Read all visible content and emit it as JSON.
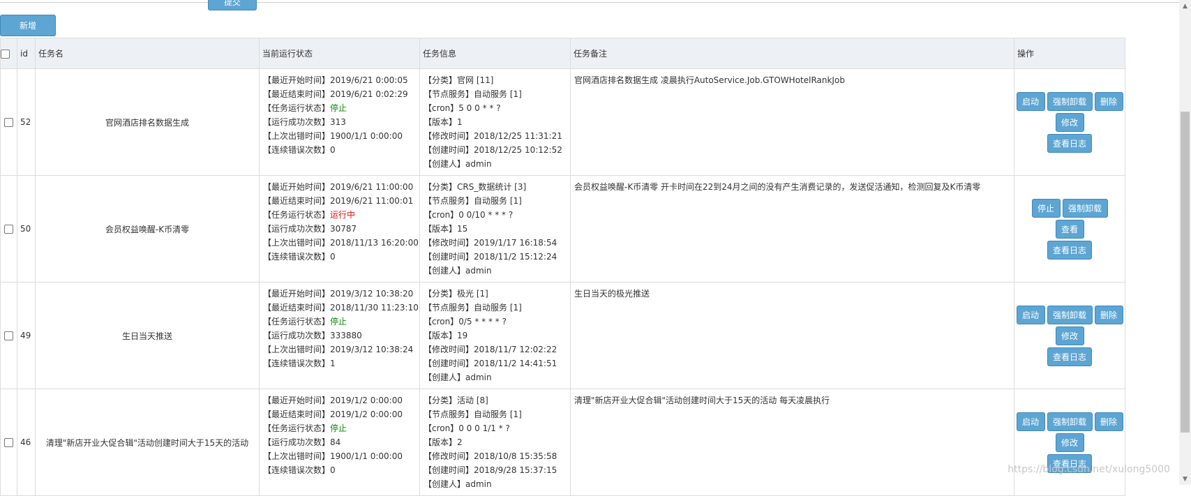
{
  "toolbar": {
    "submit_label": "提交",
    "add_label": "新增"
  },
  "table": {
    "headers": {
      "id": "id",
      "name": "任务名",
      "status": "当前运行状态",
      "info": "任务信息",
      "remark": "任务备注",
      "ops": "操作"
    },
    "rows": [
      {
        "id": "52",
        "name": "官网酒店排名数据生成",
        "status_lines": [
          "【最近开始时间】2019/6/21 0:00:05",
          "【最近结束时间】2019/6/21 0:02:29"
        ],
        "state_label": "【任务运行状态】",
        "state": "停止",
        "status_lines2": [
          "【运行成功次数】313",
          "【上次出错时间】1900/1/1 0:00:00",
          "【连续错误次数】0"
        ],
        "info_lines": [
          "【分类】官网 [11]",
          "【节点服务】自动服务 [1]",
          "【cron】5 0 0 * * ?",
          "【版本】1",
          "【修改时间】2018/12/25 11:31:21",
          "【创建时间】2018/12/25 10:12:52",
          "【创建人】admin"
        ],
        "remark": "官网酒店排名数据生成 凌晨执行AutoService.Job.GTOWHotelRankJob",
        "btn_primary": "启动",
        "btn_force": "强制卸载",
        "btn_delete": "删除",
        "btn_edit": "修改",
        "btn_log": "查看日志"
      },
      {
        "id": "50",
        "name": "会员权益唤醒-K币清零",
        "status_lines": [
          "【最近开始时间】2019/6/21 11:00:00",
          "【最近结束时间】2019/6/21 11:00:01"
        ],
        "state_label": "【任务运行状态】",
        "state": "运行中",
        "status_lines2": [
          "【运行成功次数】30787",
          "【上次出错时间】2018/11/13 16:20:00",
          "【连续错误次数】0"
        ],
        "info_lines": [
          "【分类】CRS_数据统计 [3]",
          "【节点服务】自动服务 [1]",
          "【cron】0 0/10 * * * ?",
          "【版本】15",
          "【修改时间】2019/1/17 16:18:54",
          "【创建时间】2018/11/2 15:12:24",
          "【创建人】admin"
        ],
        "remark": "会员权益唤醒-K币清零 开卡时间在22到24月之间的没有产生消费记录的，发送促活通知，检测回复及K币清零",
        "btn_primary": "停止",
        "btn_force": "强制卸载",
        "btn_delete": "",
        "btn_edit": "查看",
        "btn_log": "查看日志"
      },
      {
        "id": "49",
        "name": "生日当天推送",
        "status_lines": [
          "【最近开始时间】2019/3/12 10:38:20",
          "【最近结束时间】2018/11/30 11:23:10"
        ],
        "state_label": "【任务运行状态】",
        "state": "停止",
        "status_lines2": [
          "【运行成功次数】333880",
          "【上次出错时间】2019/3/12 10:38:24",
          "【连续错误次数】1"
        ],
        "info_lines": [
          "【分类】极光 [1]",
          "【节点服务】自动服务 [1]",
          "【cron】0/5 * * * * ?",
          "【版本】19",
          "【修改时间】2018/11/7 12:02:22",
          "【创建时间】2018/11/2 14:41:51",
          "【创建人】admin"
        ],
        "remark": "生日当天的极光推送",
        "btn_primary": "启动",
        "btn_force": "强制卸载",
        "btn_delete": "删除",
        "btn_edit": "修改",
        "btn_log": "查看日志"
      },
      {
        "id": "46",
        "name": "清理\"新店开业大促合辑\"活动创建时间大于15天的活动",
        "status_lines": [
          "【最近开始时间】2019/1/2 0:00:00",
          "【最近结束时间】2019/1/2 0:00:00"
        ],
        "state_label": "【任务运行状态】",
        "state": "停止",
        "status_lines2": [
          "【运行成功次数】84",
          "【上次出错时间】1900/1/1 0:00:00",
          "【连续错误次数】0"
        ],
        "info_lines": [
          "【分类】活动 [8]",
          "【节点服务】自动服务 [1]",
          "【cron】0 0 0 1/1 * ?",
          "【版本】2",
          "【修改时间】2018/10/8 15:35:58",
          "【创建时间】2018/9/28 15:37:15",
          "【创建人】admin"
        ],
        "remark": "清理\"新店开业大促合辑\"活动创建时间大于15天的活动 每天凌晨执行",
        "btn_primary": "启动",
        "btn_force": "强制卸载",
        "btn_delete": "删除",
        "btn_edit": "修改",
        "btn_log": "查看日志"
      }
    ]
  },
  "watermark": "https://blog.csdn.net/xulong5000",
  "colors": {
    "button": "#5da5d3",
    "header_bg": "#edf1f5",
    "stopped": "#0a8a0a",
    "running": "#e01010"
  }
}
